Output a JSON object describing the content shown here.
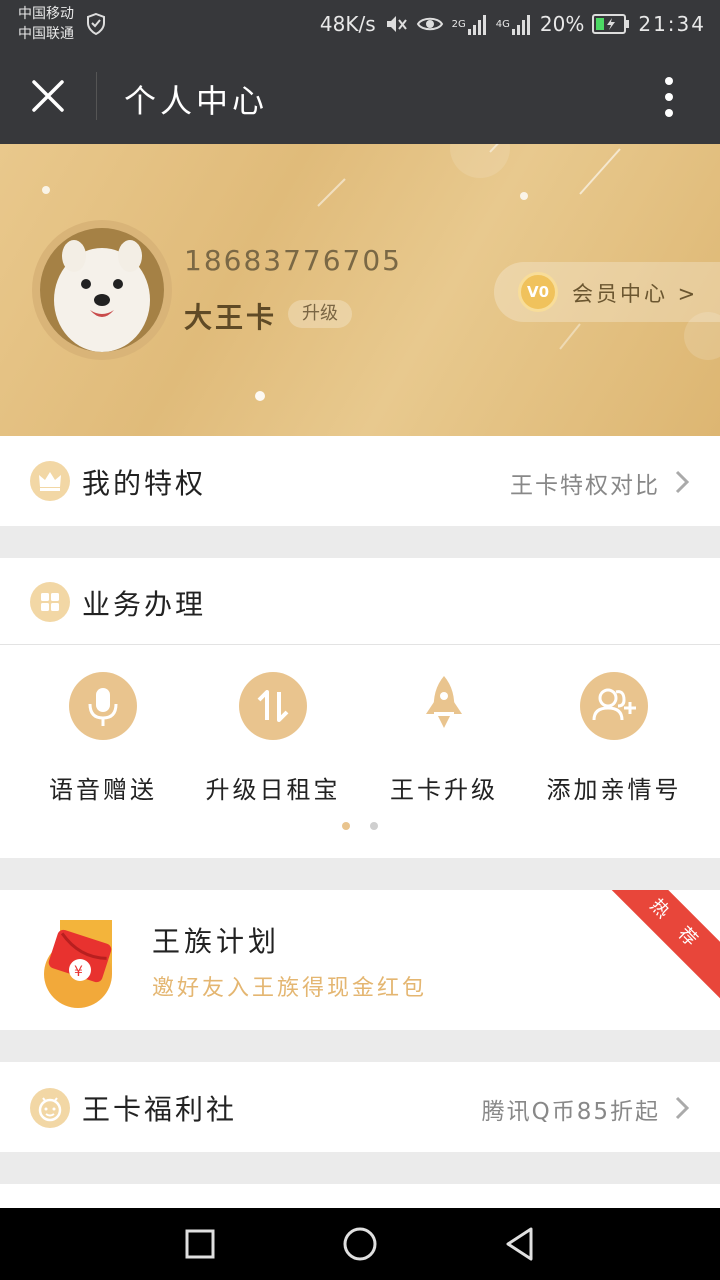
{
  "status_bar": {
    "carrier1": "中国移动",
    "carrier2": "中国联通",
    "speed": "48K/s",
    "network1": "2G",
    "network2": "4G",
    "battery": "20%",
    "time": "21:34"
  },
  "header": {
    "title": "个人中心"
  },
  "profile": {
    "phone": "18683776705",
    "card_name": "大王卡",
    "upgrade_label": "升级",
    "level_badge": "V0",
    "member_center_label": "会员中心 >"
  },
  "privilege": {
    "title": "我的特权",
    "link": "王卡特权对比"
  },
  "business": {
    "title": "业务办理",
    "services": [
      {
        "label": "语音赠送",
        "icon": "microphone-icon"
      },
      {
        "label": "升级日租宝",
        "icon": "up-down-arrows-icon"
      },
      {
        "label": "王卡升级",
        "icon": "rocket-icon"
      },
      {
        "label": "添加亲情号",
        "icon": "add-users-icon"
      }
    ],
    "pager": {
      "pages": 2,
      "current": 1
    }
  },
  "promo": {
    "title": "王族计划",
    "subtitle": "邀好友入王族得现金红包",
    "corner_badge": "热 荐"
  },
  "welfare": {
    "title": "王卡福利社",
    "link": "腾讯Q币85折起"
  },
  "colors": {
    "accent_gold": "#e9c48e",
    "badge_red": "#e8463a",
    "dark_bar": "#37383b"
  }
}
